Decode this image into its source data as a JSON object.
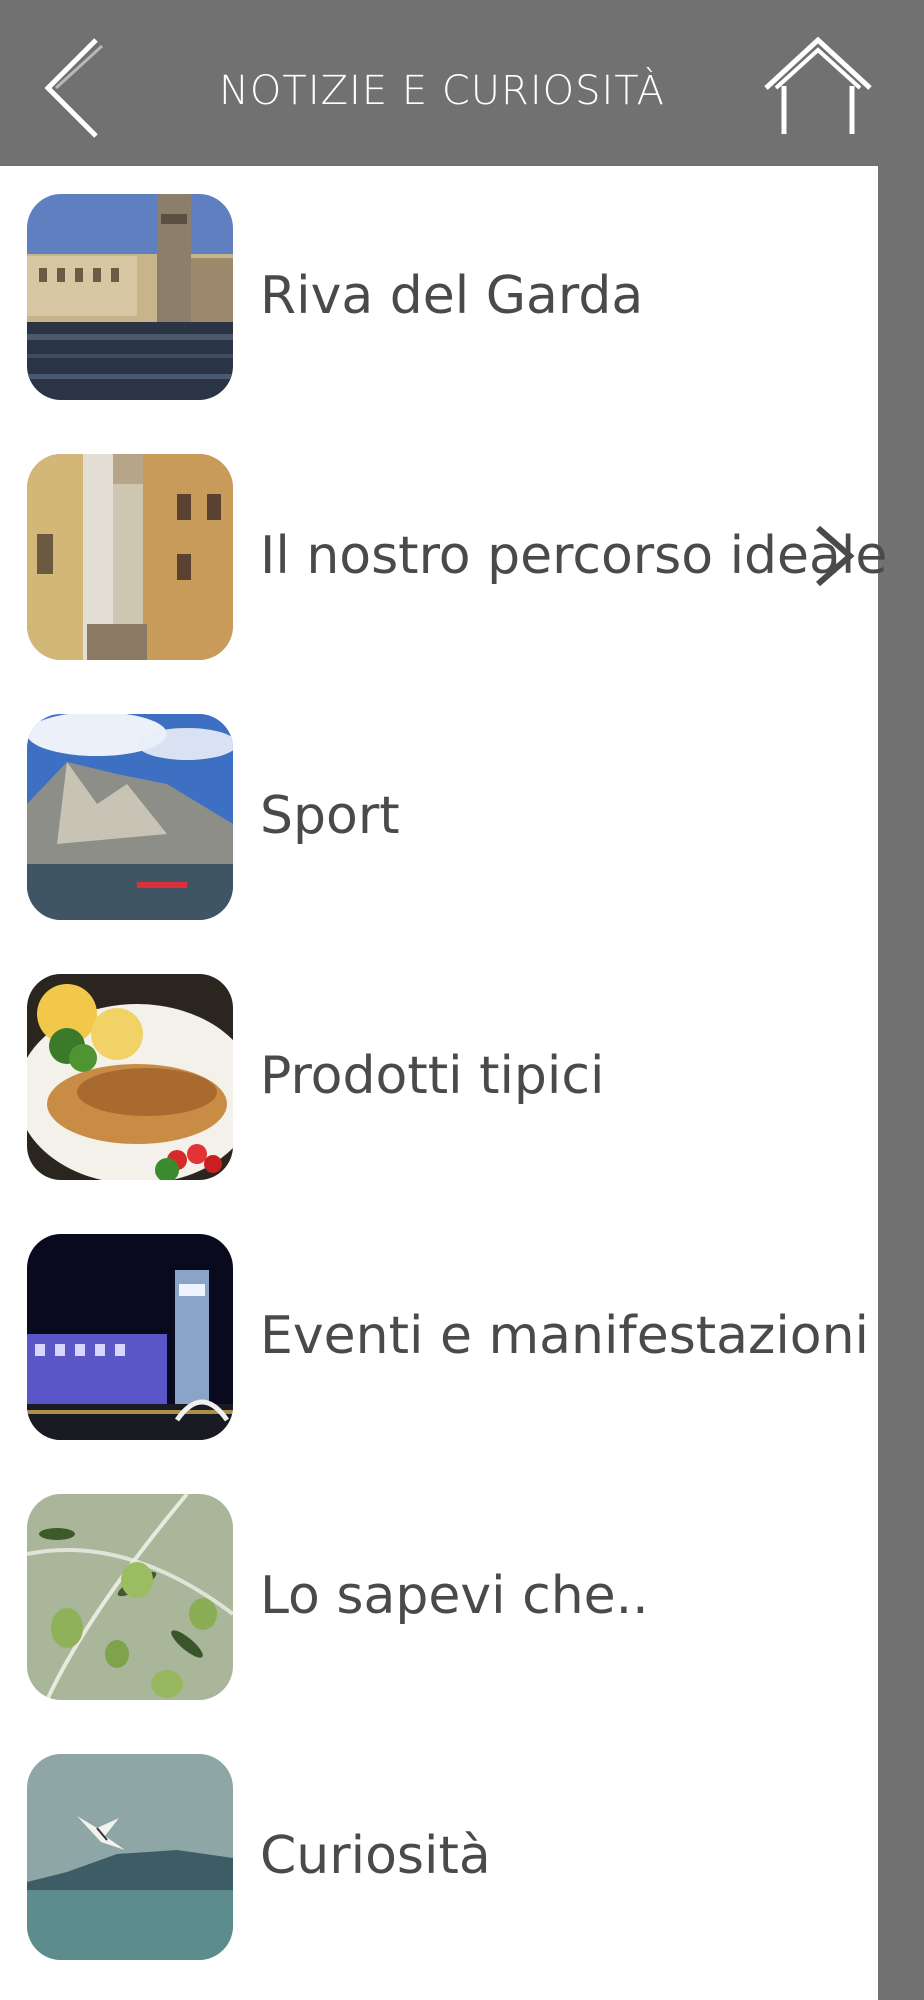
{
  "header": {
    "title": "NOTIZIE E CURIOSITÀ",
    "back_icon": "chevron-left-icon",
    "home_icon": "home-icon",
    "color": "#717171"
  },
  "list": {
    "items": [
      {
        "label": "Riva del Garda",
        "image": "lakeside-town-with-tower"
      },
      {
        "label": "Il nostro percorso ideale",
        "image": "narrow-town-street",
        "selected": true
      },
      {
        "label": "Sport",
        "image": "mountain-lake-kayak"
      },
      {
        "label": "Prodotti tipici",
        "image": "grilled-fish-plate"
      },
      {
        "label": "Eventi e manifestazioni",
        "image": "night-town-illuminated"
      },
      {
        "label": "Lo sapevi che..",
        "image": "olive-branch"
      },
      {
        "label": "Curiosità",
        "image": "seagull-over-lake"
      }
    ]
  }
}
